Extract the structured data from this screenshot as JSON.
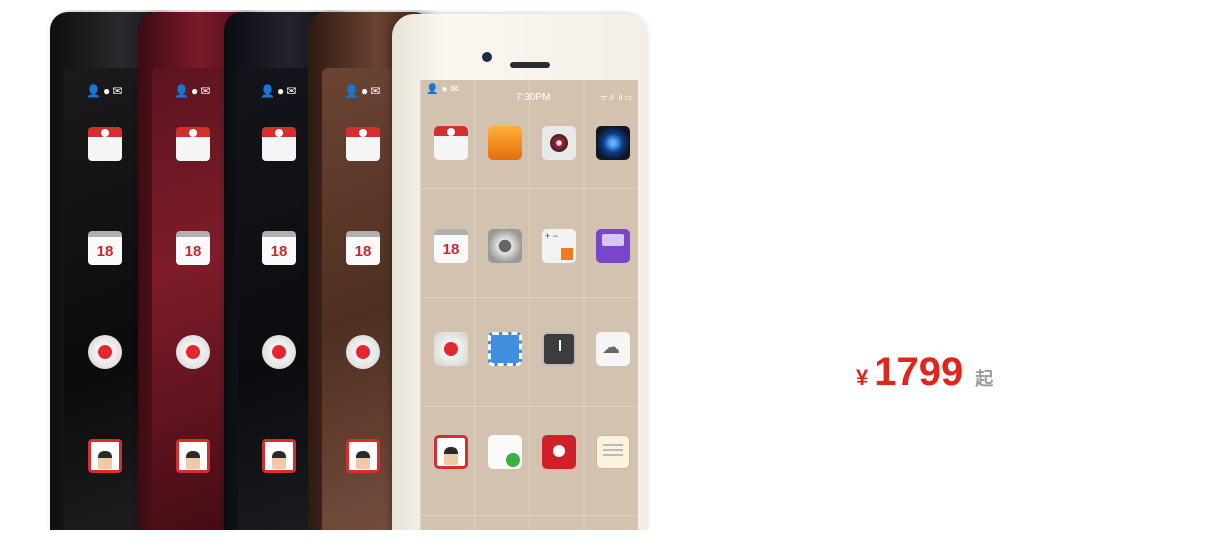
{
  "phones": {
    "front_status": {
      "time": "7:30PM",
      "left_icons": "👤●✉",
      "right_icons": "ᯤ.ıl .ıl ▭"
    },
    "side_status": "👤●✉",
    "side_icons": [
      "store-icon",
      "calendar-icon",
      "recorder-icon",
      "smart-icon"
    ],
    "front_icons": [
      "store-icon",
      "photos-icon",
      "music-icon",
      "camera-icon",
      "calendar-icon",
      "settings-icon",
      "calculator-icon",
      "game-icon",
      "recorder-icon",
      "stamp-icon",
      "clock-icon",
      "weather-icon",
      "smart-icon",
      "contacts-icon",
      "redbox-icon",
      "notes-icon"
    ]
  },
  "price": {
    "currency": "¥",
    "amount": "1799",
    "suffix": "起",
    "color": "#e1251b"
  }
}
